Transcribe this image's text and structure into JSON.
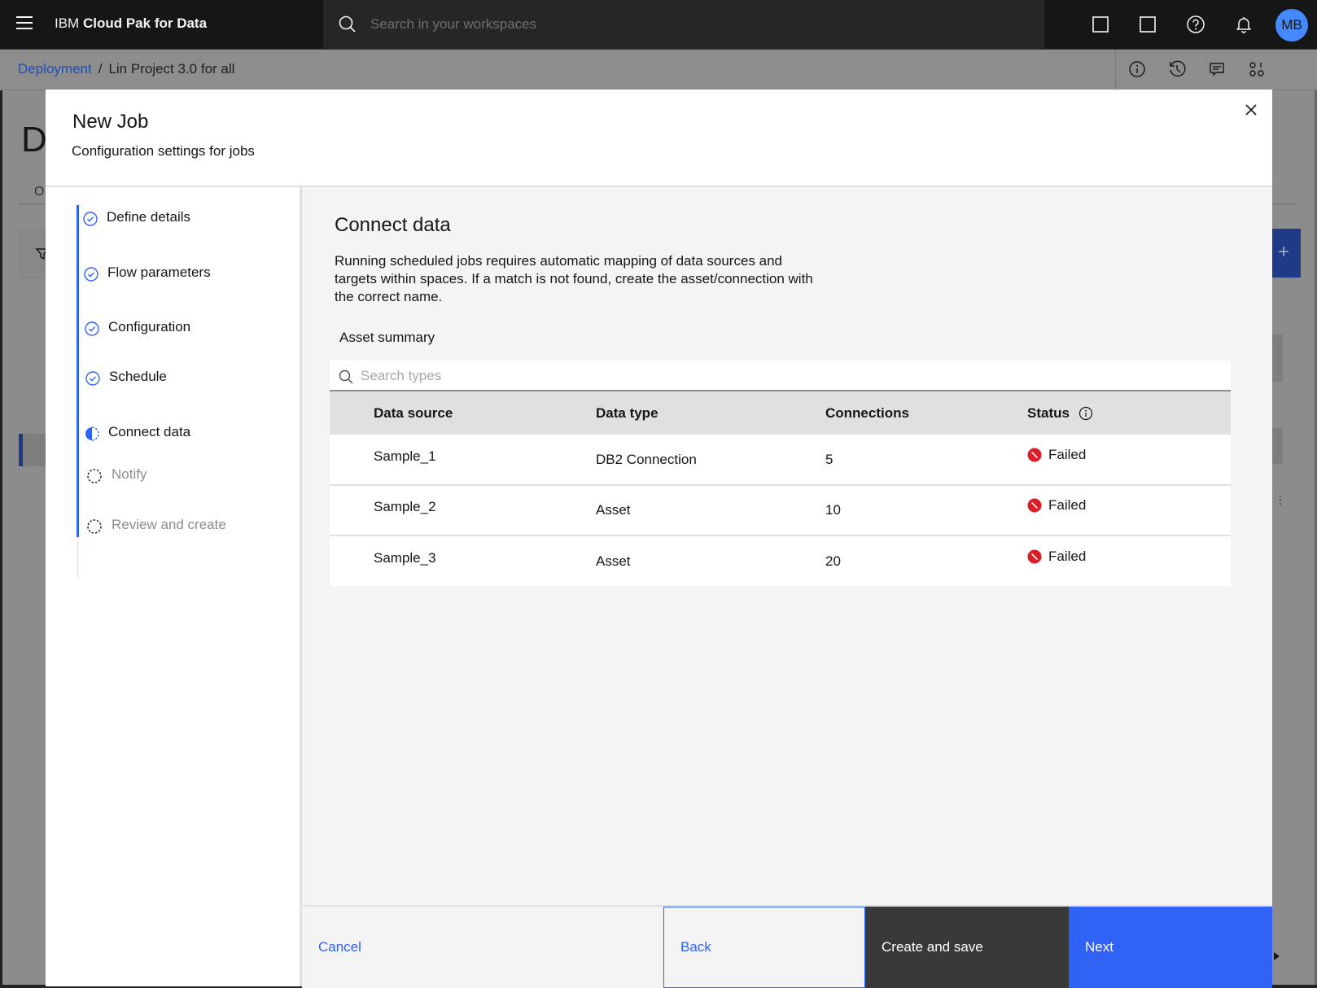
{
  "topbar": {
    "brand_prefix": "IBM",
    "brand_name": "Cloud Pak for Data",
    "search_placeholder": "Search in your workspaces",
    "icons": [
      "square-icon",
      "square-icon",
      "help-icon",
      "notification-icon"
    ],
    "avatar_initials": "MB",
    "avatar_color": "#4589ff"
  },
  "breadcrumb": {
    "link": "Deployment",
    "separator": "/",
    "current": "Lin Project 3.0 for all"
  },
  "background_page": {
    "title_fragment": "D",
    "tab_fragment": "O",
    "add_symbol": "+"
  },
  "modal": {
    "title": "New Job",
    "subtitle": "Configuration settings for jobs",
    "steps": [
      {
        "label": "Define details",
        "state": "complete"
      },
      {
        "label": "Flow parameters",
        "state": "complete"
      },
      {
        "label": "Configuration",
        "state": "complete"
      },
      {
        "label": "Schedule",
        "state": "complete"
      },
      {
        "label": "Connect data",
        "state": "current"
      },
      {
        "label": "Notify",
        "state": "incomplete"
      },
      {
        "label": "Review and create",
        "state": "incomplete"
      }
    ],
    "content": {
      "title": "Connect data",
      "description": "Running scheduled jobs requires automatic mapping of data sources and targets within spaces. If a match is not found, create the asset/connection with the correct name.",
      "asset_summary_label": "Asset summary",
      "search_placeholder": "Search types",
      "table": {
        "headers": [
          "Data source",
          "Data type",
          "Connections",
          "Status"
        ],
        "rows": [
          {
            "source": "Sample_1",
            "type": "DB2 Connection",
            "connections": "5",
            "status": "Failed"
          },
          {
            "source": "Sample_2",
            "type": "Asset",
            "connections": "10",
            "status": "Failed"
          },
          {
            "source": "Sample_3",
            "type": "Asset",
            "connections": "20",
            "status": "Failed"
          }
        ]
      }
    },
    "footer": {
      "cancel": "Cancel",
      "back": "Back",
      "create_and_save": "Create and save",
      "next": "Next"
    }
  },
  "colors": {
    "primary": "#2f62f5",
    "error": "#da1e28",
    "header_bg": "#161616"
  }
}
